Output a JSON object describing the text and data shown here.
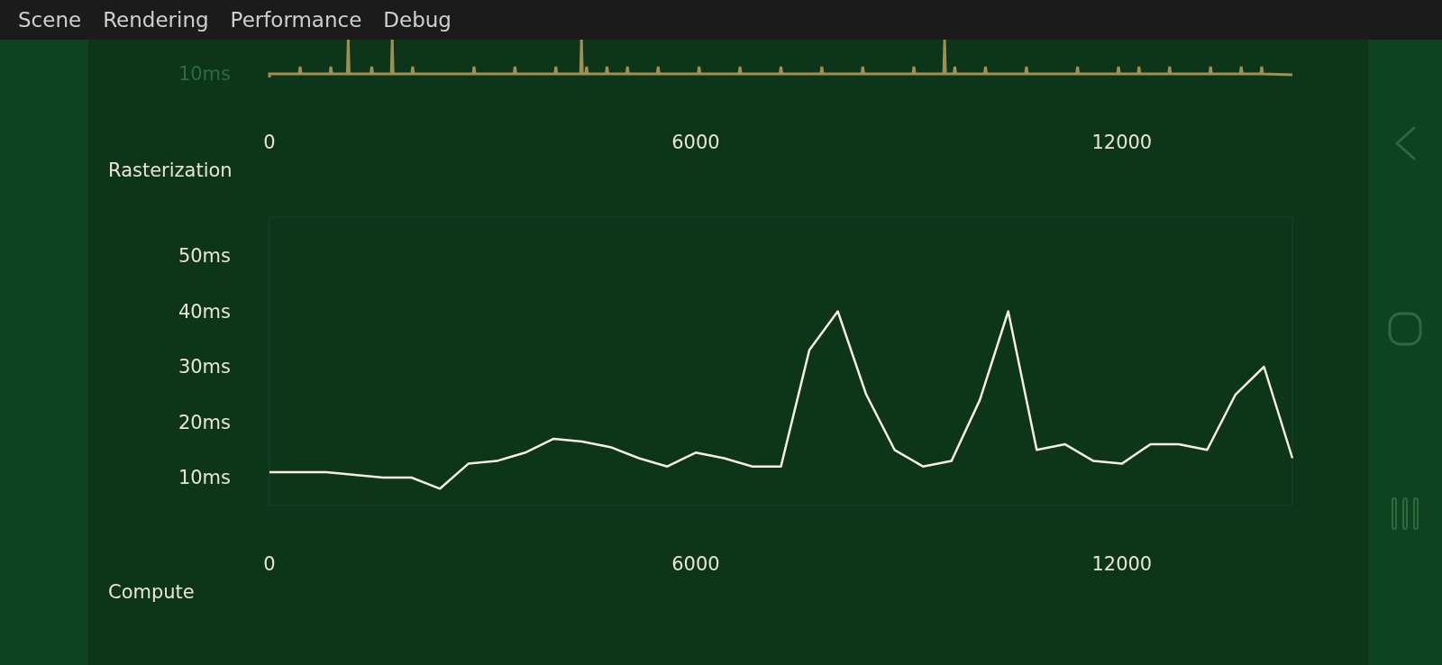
{
  "menu": [
    "Scene",
    "Rendering",
    "Performance",
    "Debug"
  ],
  "top_chart": {
    "yticks": [
      "10ms"
    ],
    "xticks": [
      "0",
      "6000",
      "12000"
    ]
  },
  "sections": [
    {
      "title": "Rasterization",
      "chart_data": {
        "type": "line",
        "xlim": [
          0,
          14400
        ],
        "ylim": [
          5,
          57
        ],
        "xticks": [
          0,
          6000,
          12000
        ],
        "yticks": [
          {
            "value": 10,
            "label": "10ms"
          },
          {
            "value": 20,
            "label": "20ms"
          },
          {
            "value": 30,
            "label": "30ms"
          },
          {
            "value": 40,
            "label": "40ms"
          },
          {
            "value": 50,
            "label": "50ms"
          }
        ],
        "x": [
          0,
          400,
          800,
          1200,
          1600,
          2000,
          2400,
          2800,
          3200,
          3600,
          4000,
          4400,
          4800,
          5200,
          5600,
          6000,
          6400,
          6800,
          7200,
          7600,
          8000,
          8400,
          8800,
          9200,
          9600,
          10000,
          10400,
          10800,
          11200,
          11600,
          12000,
          12400,
          12800,
          13200,
          13600,
          14000,
          14400
        ],
        "series": [
          {
            "color": "#f6f1df",
            "values": [
              11,
              11,
              11,
              10.5,
              10,
              10,
              8,
              12.5,
              13,
              14.5,
              17,
              16.5,
              15.5,
              13.5,
              12,
              14.5,
              13.5,
              12,
              12,
              33,
              40,
              25,
              15,
              12,
              13,
              24,
              40,
              15,
              16,
              13,
              12.5,
              16,
              16,
              15,
              25,
              30,
              13.5
            ]
          }
        ]
      }
    },
    {
      "title": "Compute"
    }
  ]
}
